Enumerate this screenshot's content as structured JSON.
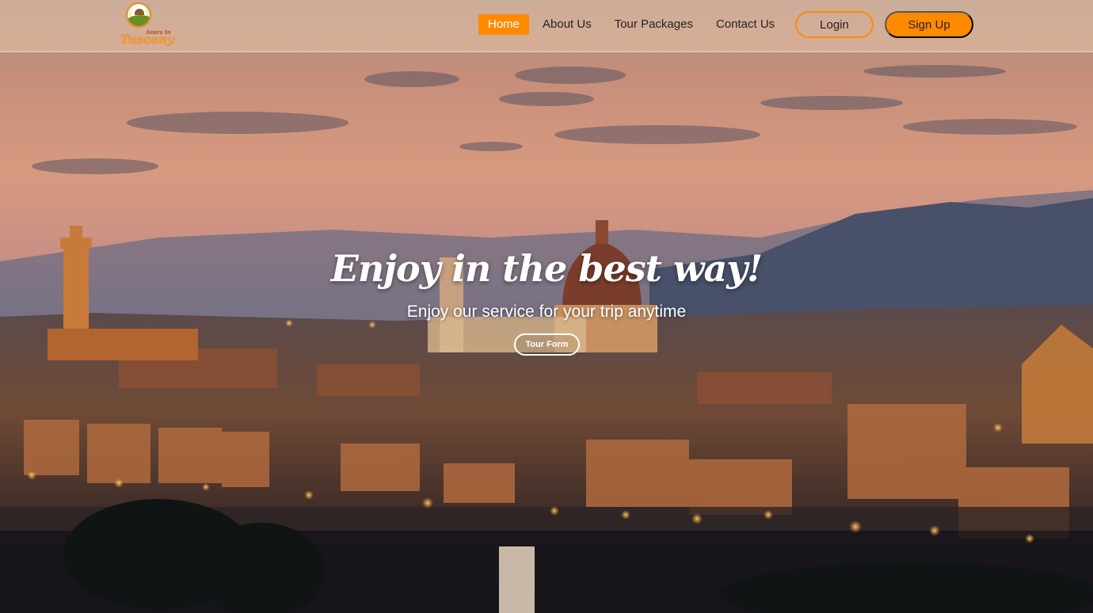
{
  "brand": {
    "logo_small": "tours in",
    "logo_name": "Tuscany"
  },
  "nav": {
    "items": [
      {
        "label": "Home",
        "active": true
      },
      {
        "label": "About Us",
        "active": false
      },
      {
        "label": "Tour Packages",
        "active": false
      },
      {
        "label": "Contact Us",
        "active": false
      }
    ],
    "login_label": "Login",
    "signup_label": "Sign Up"
  },
  "hero": {
    "title": "Enjoy in the best way!",
    "subtitle": "Enjoy our service for your trip anytime",
    "cta_label": "Tour Form"
  },
  "colors": {
    "accent": "#ff8a00",
    "nav_text": "#2b2220",
    "hero_text": "#ffffff"
  }
}
